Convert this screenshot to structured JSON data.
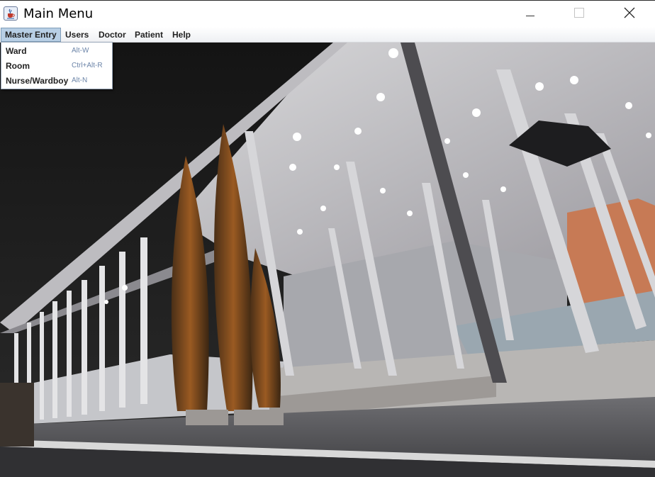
{
  "window": {
    "title": "Main Menu",
    "icon": "java-cup-icon",
    "controls": [
      "minimize-icon",
      "maximize-icon",
      "close-icon"
    ]
  },
  "menubar": {
    "items": [
      {
        "label": "Master Entry",
        "active": true
      },
      {
        "label": "Users"
      },
      {
        "label": "Doctor"
      },
      {
        "label": "Patient"
      },
      {
        "label": "Help"
      }
    ]
  },
  "master_entry_menu": {
    "items": [
      {
        "label": "Ward",
        "accelerator": "Alt-W"
      },
      {
        "label": "Room",
        "accelerator": "Ctrl+Alt-R"
      },
      {
        "label": "Nurse/Wardboy",
        "accelerator": "Alt-N"
      }
    ]
  },
  "colors": {
    "menu_active_bg": "#b8cfe5",
    "menu_active_border": "#7f9db9",
    "accelerator_text": "#6b84a8"
  }
}
